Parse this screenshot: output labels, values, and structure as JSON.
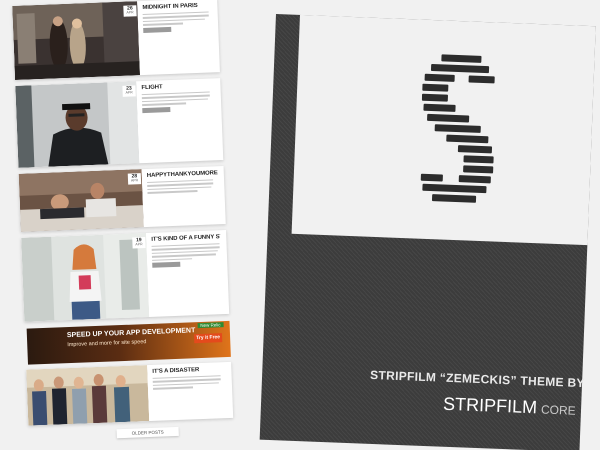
{
  "posts": [
    {
      "title": "MIDNIGHT IN PARIS",
      "day": "26",
      "month": "APR"
    },
    {
      "title": "FLIGHT",
      "day": "23",
      "month": "APR"
    },
    {
      "title": "HAPPYTHANKYOUMOREPLEASE",
      "day": "28",
      "month": "APR"
    },
    {
      "title": "IT'S KIND OF A FUNNY STORY",
      "day": "19",
      "month": "APR"
    },
    {
      "title": "IT'S A DISASTER",
      "day": "",
      "month": ""
    }
  ],
  "ad": {
    "headline": "SPEED UP YOUR APP DEVELOPMENT",
    "subline": "Improve and more for site speed",
    "cta": "Try it Free",
    "badge": "New Relic"
  },
  "older_posts_label": "OLDER POSTS",
  "promo": {
    "theme_line": "STRIPFILM “ZEMECKIS” THEME BY",
    "brand": "STRIPFILM",
    "brand_suffix": "CORE"
  }
}
